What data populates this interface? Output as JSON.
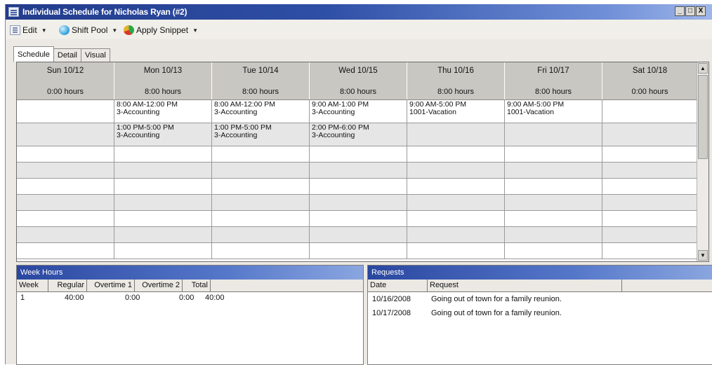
{
  "window": {
    "title": "Individual Schedule for Nicholas Ryan (#2)",
    "controls": [
      "_",
      "□",
      "X"
    ]
  },
  "toolbar": {
    "edit_label": "Edit",
    "shift_pool_label": "Shift Pool",
    "apply_snippet_label": "Apply Snippet"
  },
  "tabs": [
    "Schedule",
    "Detail",
    "Visual"
  ],
  "schedule": {
    "days": [
      {
        "day": "Sun 10/12",
        "hours": "0:00 hours"
      },
      {
        "day": "Mon 10/13",
        "hours": "8:00 hours"
      },
      {
        "day": "Tue 10/14",
        "hours": "8:00 hours"
      },
      {
        "day": "Wed 10/15",
        "hours": "8:00 hours"
      },
      {
        "day": "Thu 10/16",
        "hours": "8:00 hours"
      },
      {
        "day": "Fri 10/17",
        "hours": "8:00 hours"
      },
      {
        "day": "Sat 10/18",
        "hours": "0:00 hours"
      }
    ],
    "rows": [
      [
        {
          "time": "",
          "dept": ""
        },
        {
          "time": "8:00 AM-12:00 PM",
          "dept": "3-Accounting"
        },
        {
          "time": "8:00 AM-12:00 PM",
          "dept": "3-Accounting"
        },
        {
          "time": "9:00 AM-1:00 PM",
          "dept": "3-Accounting"
        },
        {
          "time": "9:00 AM-5:00 PM",
          "dept": "1001-Vacation"
        },
        {
          "time": "9:00 AM-5:00 PM",
          "dept": "1001-Vacation"
        },
        {
          "time": "",
          "dept": ""
        }
      ],
      [
        {
          "time": "",
          "dept": ""
        },
        {
          "time": "1:00 PM-5:00 PM",
          "dept": "3-Accounting"
        },
        {
          "time": "1:00 PM-5:00 PM",
          "dept": "3-Accounting"
        },
        {
          "time": "2:00 PM-6:00 PM",
          "dept": "3-Accounting"
        },
        {
          "time": "",
          "dept": ""
        },
        {
          "time": "",
          "dept": ""
        },
        {
          "time": "",
          "dept": ""
        }
      ]
    ],
    "empty_row_count": 7
  },
  "week_hours": {
    "title": "Week Hours",
    "columns": [
      "Week",
      "Regular",
      "Overtime 1",
      "Overtime 2",
      "Total"
    ],
    "rows": [
      {
        "week": "1",
        "regular": "40:00",
        "overtime1": "0:00",
        "overtime2": "0:00",
        "total": "40:00"
      }
    ]
  },
  "requests": {
    "title": "Requests",
    "columns": [
      "Date",
      "Request"
    ],
    "rows": [
      {
        "date": "10/16/2008",
        "request": "Going out of town for a family reunion."
      },
      {
        "date": "10/17/2008",
        "request": "Going out of town for a family reunion."
      }
    ]
  }
}
